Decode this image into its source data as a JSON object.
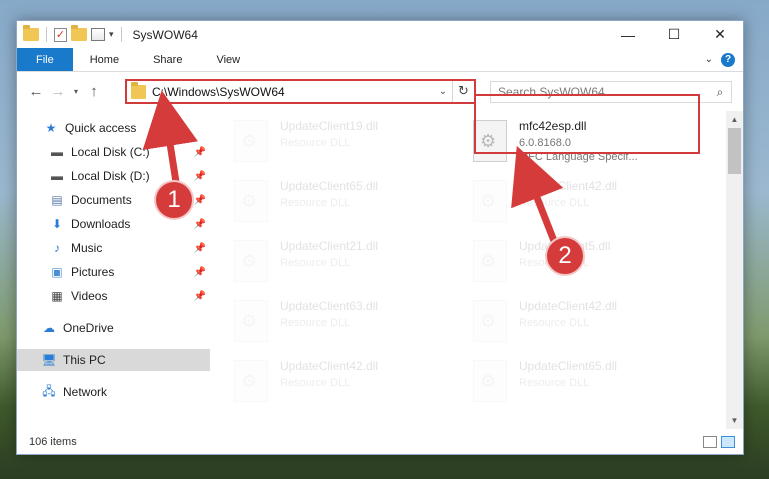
{
  "window": {
    "title": "SysWOW64",
    "minimize": "—",
    "maximize": "☐",
    "close": "✕"
  },
  "ribbon": {
    "tabs": [
      "File",
      "Home",
      "Share",
      "View"
    ]
  },
  "address": {
    "path": "C:\\Windows\\SysWOW64"
  },
  "search": {
    "placeholder": "Search SysWOW64"
  },
  "nav": {
    "items": [
      {
        "label": "Quick access",
        "icon": "star-icon"
      },
      {
        "label": "Local Disk (C:)",
        "icon": "drive-icon"
      },
      {
        "label": "Local Disk (D:)",
        "icon": "drive-icon"
      },
      {
        "label": "Documents",
        "icon": "documents-icon"
      },
      {
        "label": "Downloads",
        "icon": "download-icon"
      },
      {
        "label": "Music",
        "icon": "music-icon"
      },
      {
        "label": "Pictures",
        "icon": "pictures-icon"
      },
      {
        "label": "Videos",
        "icon": "videos-icon"
      },
      {
        "label": "OneDrive",
        "icon": "cloud-icon"
      },
      {
        "label": "This PC",
        "icon": "computer-icon"
      },
      {
        "label": "Network",
        "icon": "network-icon"
      }
    ]
  },
  "files": {
    "highlighted": {
      "name": "mfc42esp.dll",
      "version": "6.0.8168.0",
      "description": "MFC Language Specif..."
    },
    "left_column": [
      {
        "name": "UpdateClient19.dll",
        "type": "Resource DLL"
      },
      {
        "name": "UpdateClient65.dll",
        "type": "Resource DLL"
      },
      {
        "name": "UpdateClient21.dll",
        "type": "Resource DLL"
      },
      {
        "name": "UpdateClient63.dll",
        "type": "Resource DLL"
      },
      {
        "name": "UpdateClient42.dll",
        "type": "Resource DLL"
      }
    ],
    "right_column": [
      {
        "name": "UpdateClient42.dll",
        "type": "Resource DLL"
      },
      {
        "name": "UpdateClient5.dll",
        "type": "Resource DLL"
      },
      {
        "name": "UpdateClient42.dll",
        "type": "Resource DLL"
      },
      {
        "name": "UpdateClient65.dll",
        "type": "Resource DLL"
      }
    ]
  },
  "status": {
    "count": "106 items"
  },
  "annotations": {
    "marker1": "1",
    "marker2": "2",
    "color": "#d63b3b"
  }
}
